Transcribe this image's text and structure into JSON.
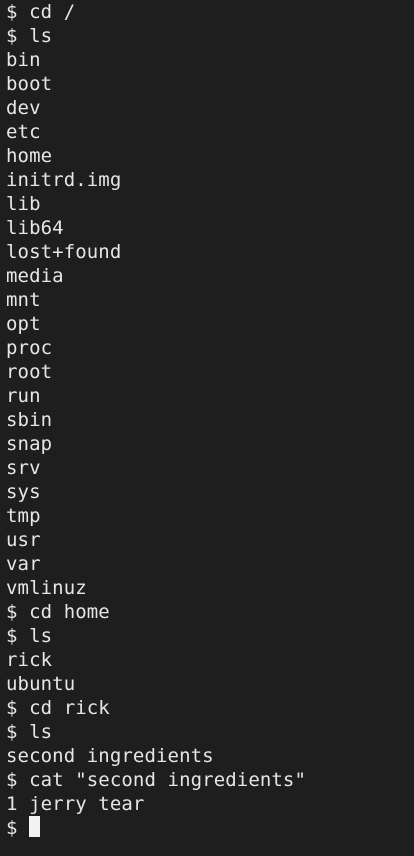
{
  "terminal": {
    "lines": [
      "$ cd /",
      "$ ls",
      "bin",
      "boot",
      "dev",
      "etc",
      "home",
      "initrd.img",
      "lib",
      "lib64",
      "lost+found",
      "media",
      "mnt",
      "opt",
      "proc",
      "root",
      "run",
      "sbin",
      "snap",
      "srv",
      "sys",
      "tmp",
      "usr",
      "var",
      "vmlinuz",
      "$ cd home",
      "$ ls",
      "rick",
      "ubuntu",
      "$ cd rick",
      "$ ls",
      "second ingredients",
      "$ cat \"second ingredients\"",
      "1 jerry tear"
    ],
    "prompt": "$ ",
    "colors": {
      "background": "#1e1e1e",
      "text": "#e6e6e6",
      "cursor": "#f2f2f2"
    }
  }
}
